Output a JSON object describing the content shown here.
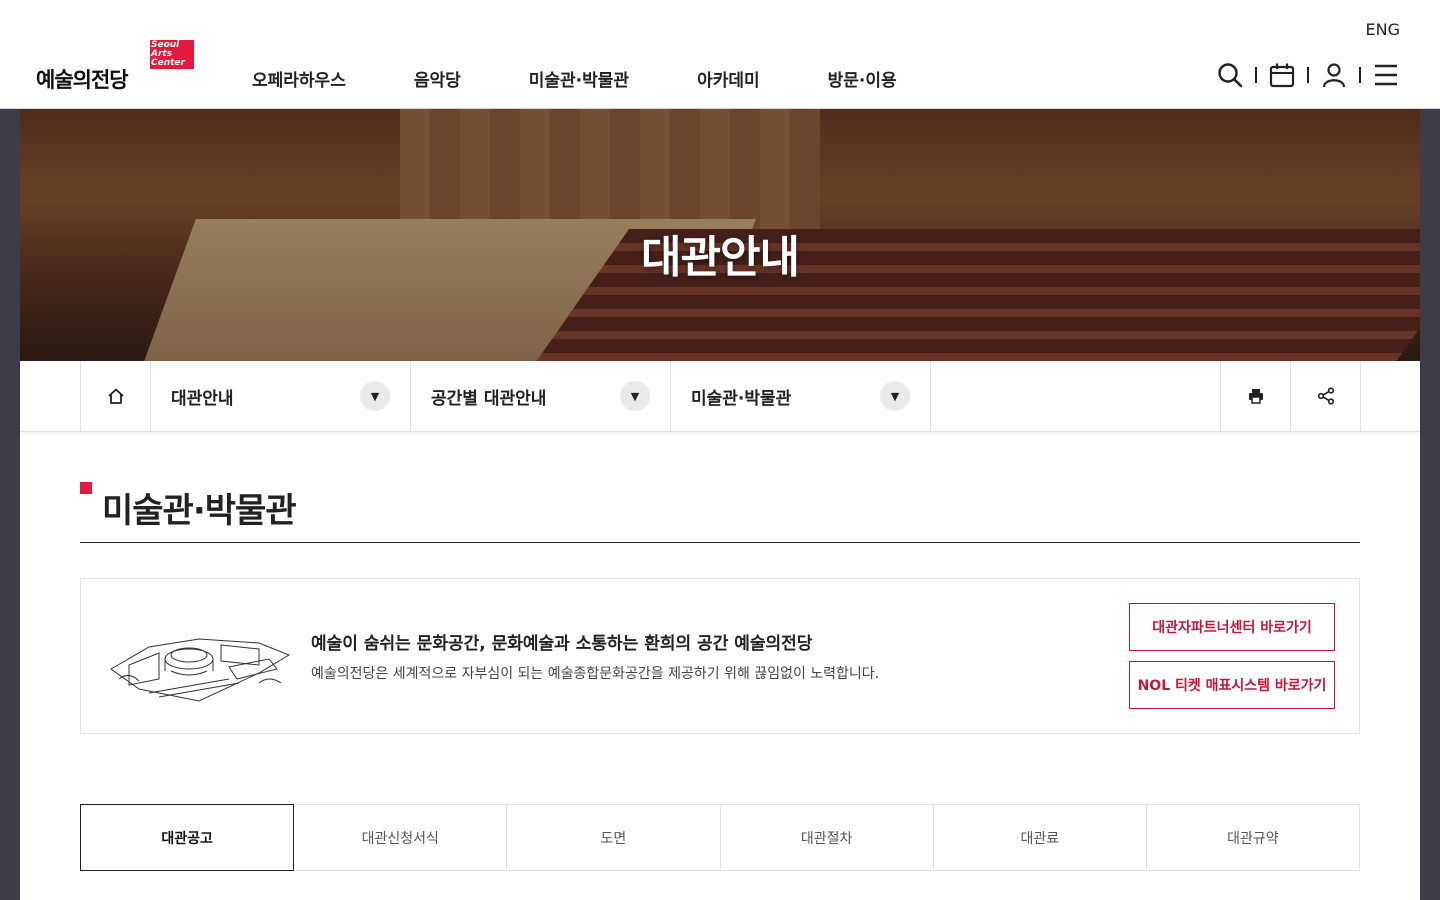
{
  "header": {
    "logo_text": "예술의전당",
    "logo_badge": "Seoul\nArts\nCenter",
    "lang": "ENG",
    "nav": [
      "오페라하우스",
      "음악당",
      "미술관·박물관",
      "아카데미",
      "방문·이용"
    ],
    "util_icons": [
      "search-icon",
      "calendar-icon",
      "user-icon",
      "menu-icon"
    ]
  },
  "hero": {
    "title": "대관안내"
  },
  "locbar": {
    "home_icon": "home-icon",
    "depth1": "대관안내",
    "depth2": "공간별 대관안내",
    "depth3": "미술관·박물관",
    "print_icon": "print-icon",
    "share_icon": "share-icon"
  },
  "page": {
    "title": "미술관·박물관"
  },
  "info": {
    "headline": "예술이 숨쉬는 문화공간, 문화예술과 소통하는 환희의 공간 예술의전당",
    "description": "예술의전당은 세계적으로 자부심이 되는 예술종합문화공간을 제공하기 위해 끊임없이 노력합니다.",
    "button1": "대관자파트너센터 바로가기",
    "button2": "NOL 티켓 매표시스템 바로가기"
  },
  "tabs": [
    "대관공고",
    "대관신청서식",
    "도면",
    "대관절차",
    "대관료",
    "대관규약"
  ],
  "active_tab": "대관공고",
  "colors": {
    "accent": "#e3193d",
    "button_red": "#c6173a",
    "page_bg": "#3d3c48"
  }
}
